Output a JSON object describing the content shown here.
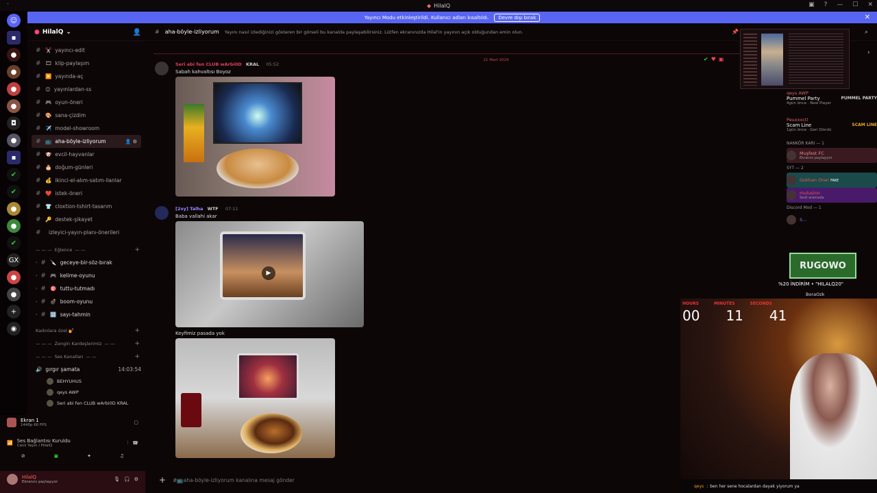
{
  "window": {
    "title": "HilalQ"
  },
  "banner": {
    "text": "Yayıncı Modu etkinleştirildi. Kullanıcı adları kısaltıldı.",
    "button": "Devre dışı bırak"
  },
  "server": {
    "name": "HilalQ"
  },
  "channels": [
    {
      "label": "yayıncı-edit",
      "emoji": "✂️",
      "active": false
    },
    {
      "label": "klip-paylaşım",
      "emoji": "🎞",
      "active": false
    },
    {
      "label": "yayında-aç",
      "emoji": "▶️",
      "active": false
    },
    {
      "label": "yayınlardan-ss",
      "emoji": "😊",
      "active": false
    },
    {
      "label": "oyun-öneri",
      "emoji": "🎮",
      "active": false
    },
    {
      "label": "sana-çizdim",
      "emoji": "🎨",
      "active": false
    },
    {
      "label": "model-showroom",
      "emoji": "✈️",
      "active": false
    },
    {
      "label": "aha-böyle-izliyorum",
      "emoji": "📺",
      "active": true
    },
    {
      "label": "evcil-hayvanlar",
      "emoji": "🐶",
      "active": false
    },
    {
      "label": "doğum-günleri",
      "emoji": "🎂",
      "active": false
    },
    {
      "label": "ikinci-el-alım-satım-ilanlar",
      "emoji": "💰",
      "active": false
    },
    {
      "label": "istek-öneri",
      "emoji": "❤️",
      "active": false
    },
    {
      "label": "cloxtion-tshirt-tasarım",
      "emoji": "👕",
      "active": false
    },
    {
      "label": "destek-şikayet",
      "emoji": "🔑",
      "active": false
    },
    {
      "label": "izleyici-yayın-planı-önerileri",
      "emoji": "",
      "active": false
    }
  ],
  "category_fun": "Eğlence",
  "fun_channels": [
    {
      "label": "geceye-bir-söz-bırak",
      "emoji": "🔪"
    },
    {
      "label": "kelime-oyunu",
      "emoji": "🎮"
    },
    {
      "label": "tuttu-tutmadı",
      "emoji": "🎯"
    },
    {
      "label": "boom-oyunu",
      "emoji": "💣"
    },
    {
      "label": "sayı-tahmin",
      "emoji": "🔢"
    }
  ],
  "category_women": "Kadınlara özel 💅",
  "category_rich": "Zengin Kardeşlerimiz",
  "category_voice": "Ses Kanalları",
  "voice": {
    "channel": "gırgır şamata",
    "timer": "14:03:54",
    "users": [
      "BEHYUHUS",
      "qeys AWP",
      "Seri abi fen CLUB wArbi0D KRAL"
    ]
  },
  "screen": {
    "title": "Ekran 1",
    "sub": "1440p 60 FPS"
  },
  "connection": {
    "title": "Ses Bağlantısı Kuruldu",
    "sub": "Canlı Yayın / HilalQ"
  },
  "user": {
    "name": "HilalQ",
    "status": "Ekranını paylaşıyor"
  },
  "topic": {
    "channel": "aha-böyle-izliyorum",
    "desc": "Yayını nasıl izlediğinizi gösteren bir görseli bu kanalda paylaşabilirsiniz. Lütfen ekranınızda Hilal'in yayının açık olduğundan emin olun."
  },
  "date_divider": "21 Mart 2024",
  "messages": [
    {
      "user": "Seri abi fen CLUB wArbi0D",
      "badge": "KRAL",
      "time": "05:52",
      "text": "Sabah kahvaltısı Boyoz",
      "color": "#e0405a"
    },
    {
      "user": "[2xy] Talha",
      "badge": "WTF",
      "time": "07:11",
      "text": "Baba vallahi akar",
      "color": "#9b8cff"
    },
    {
      "user": "",
      "badge": "",
      "time": "",
      "text": "Keyfimiz pasada yok",
      "color": "#ddd"
    }
  ],
  "compose": {
    "placeholder": "#📺aha-böyle-izliyorum kanalına mesaj gönder"
  },
  "members": {
    "activity": [
      {
        "name": "qeys AWP",
        "game": "Pummel Party",
        "sub": "4gün önce · New Player"
      },
      {
        "name": "Peuxxxctl",
        "game": "Scam Line",
        "sub": "1gün önce · Geri Döndü"
      }
    ],
    "sections": [
      {
        "title": "NANKÖR KARI — 1",
        "members": [
          {
            "name": "Muşfest FC",
            "sub": "Ekranını paylaşıyor"
          }
        ]
      },
      {
        "title": "SYT — 2",
        "members": [
          {
            "name": "Gokhan Oner",
            "sub": "FAKE"
          },
          {
            "name": "mulusinn",
            "sub": "Sesli aramada"
          }
        ]
      },
      {
        "title": "Discord Mod — 1",
        "members": [
          {
            "name": "S...",
            "sub": ""
          }
        ]
      }
    ]
  },
  "overlay": {
    "logo": "RUGOWO",
    "code": "%20 İNDİRİM • \"HILALQ20\"",
    "member_below": "BoraOzk"
  },
  "timer": {
    "hours_label": "HOURS",
    "minutes_label": "MINUTES",
    "seconds_label": "SECONDS",
    "hours": "00",
    "minutes": "11",
    "seconds": "41"
  },
  "chat_line": {
    "user": "qeys",
    "text": "ben her sene hocalardan dayak yiyorum ya"
  }
}
